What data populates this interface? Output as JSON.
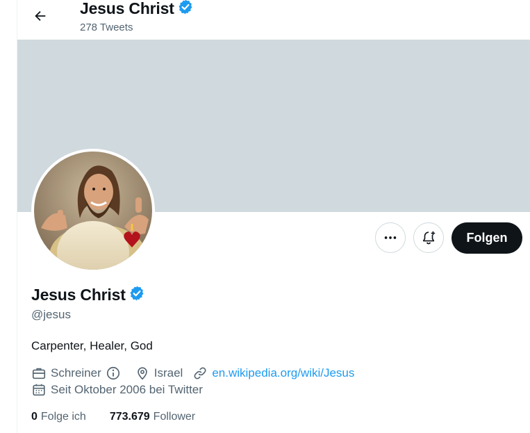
{
  "header": {
    "back_label": "Back",
    "name": "Jesus Christ",
    "tweet_count": "278 Tweets"
  },
  "profile": {
    "name": "Jesus Christ",
    "handle": "@jesus",
    "bio": "Carpenter, Healer, God",
    "category": "Schreiner",
    "location": "Israel",
    "website": "en.wikipedia.org/wiki/Jesus",
    "joined": "Seit Oktober 2006 bei Twitter",
    "verified": true
  },
  "actions": {
    "more_icon": "more-icon",
    "notify_icon": "notification-add-icon",
    "follow_label": "Folgen"
  },
  "stats": {
    "following_count": "0",
    "following_label": "Folge ich",
    "followers_count": "773.679",
    "followers_label": "Follower"
  },
  "colors": {
    "accent": "#1d9bf0",
    "banner": "#cfd9de",
    "text_secondary": "#536471",
    "follow_button": "#0f1419"
  }
}
